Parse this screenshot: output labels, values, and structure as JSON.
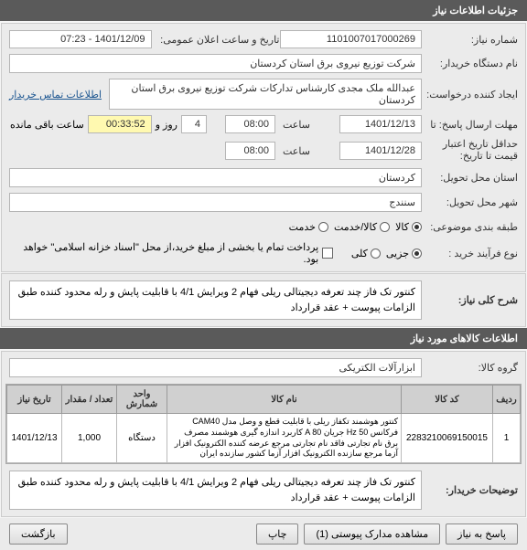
{
  "header": {
    "title": "جزئیات اطلاعات نیاز"
  },
  "fields": {
    "need_no_label": "شماره نیاز:",
    "need_no": "1101007017000269",
    "announce_label": "تاریخ و ساعت اعلان عمومی:",
    "announce": "1401/12/09 - 07:23",
    "buyer_label": "نام دستگاه خریدار:",
    "buyer": "شرکت توزیع نیروی برق استان کردستان",
    "requester_label": "ایجاد کننده درخواست:",
    "requester": "عبدالله ملک مجدی کارشناس تدارکات شرکت توزیع نیروی برق استان کردستان",
    "contact_link": "اطلاعات تماس خریدار",
    "deadline_label": "مهلت ارسال پاسخ: تا",
    "deadline_date": "1401/12/13",
    "time_label": "ساعت",
    "deadline_time": "08:00",
    "day_label": "روز و",
    "days": "4",
    "remaining": "00:33:52",
    "remaining_label": "ساعت باقی مانده",
    "credit_label": "حداقل تاریخ اعتبار قیمت تا تاریخ:",
    "credit_date": "1401/12/28",
    "credit_time": "08:00",
    "province_label": "استان محل تحویل:",
    "province": "کردستان",
    "city_label": "شهر محل تحویل:",
    "city": "سنندج",
    "category_label": "طبقه بندی موضوعی:",
    "cat_kala": "کالا",
    "cat_service": "کالا/خدمت",
    "cat_type": "خدمت",
    "process_label": "نوع فرآیند خرید :",
    "proc_partial": "جزیی",
    "proc_full": "کلی",
    "payment_hint": "پرداخت تمام یا بخشی از مبلغ خرید،از محل \"اسناد خزانه اسلامی\" خواهد بود."
  },
  "desc": {
    "label": "شرح کلی نیاز:",
    "text": "کنتور تک فاز چند تعرفه دیجیتالی ریلی فهام 2 ویرایش 4/1 با قابلیت پایش و رله محدود کننده طبق الزامات پیوست + عقد قرارداد"
  },
  "goods": {
    "header": "اطلاعات کالاهای مورد نیاز",
    "group_label": "گروه کالا:",
    "group": "ابزارآلات الکتریکی",
    "cols": [
      "ردیف",
      "کد کالا",
      "نام کالا",
      "واحد شمارش",
      "تعداد / مقدار",
      "تاریخ نیاز"
    ],
    "rows": [
      {
        "idx": "1",
        "code": "2283210069150015",
        "name": "کنتور هوشمند تکفاز ریلی با قابلیت قطع و وصل مدل CAM40 فرکانس Hz 50 جریان A 80 کاربرد اندازه گیری هوشمند مصرف برق نام تجارتی فاقد نام تجارتی مرجع عرضه کننده الکترونیک افزار آزما مرجع سازنده الکترونیک افزار آزما کشور سازنده ایران",
        "unit": "دستگاه",
        "qty": "1,000",
        "date": "1401/12/13"
      }
    ]
  },
  "buyer_notes": {
    "label": "توضیحات خریدار:",
    "text": "کنتور تک فاز چند تعرفه دیجیتالی ریلی فهام 2 ویرایش 4/1 با قابلیت پایش و رله محدود کننده طبق الزامات پیوست + عقد قرارداد"
  },
  "footer": {
    "reply": "پاسخ به نیاز",
    "attach": "مشاهده مدارک پیوستی (1)",
    "print": "چاپ",
    "back": "بازگشت"
  }
}
